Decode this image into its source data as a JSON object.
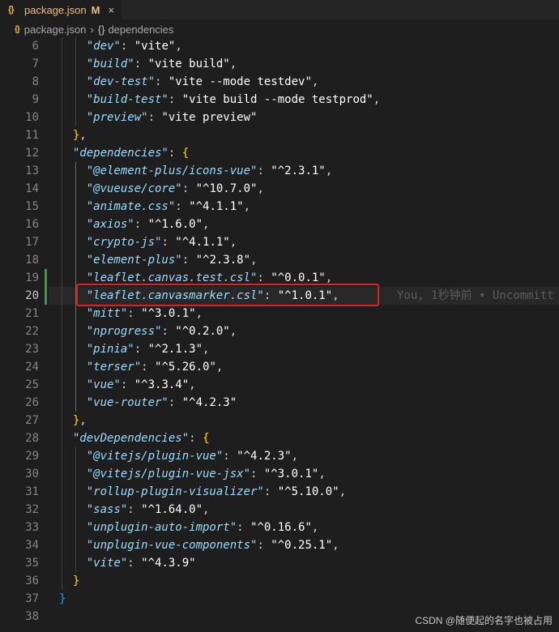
{
  "tab": {
    "icon": "{}",
    "icon_name": "json-icon",
    "filename": "package.json",
    "status": "M",
    "close": "×"
  },
  "breadcrumb": {
    "icon": "{}",
    "file": "package.json",
    "separator": "›",
    "braces": "{}",
    "path": "dependencies"
  },
  "blame": "You, 1秒钟前 • Uncommitt",
  "watermark": "CSDN @随便起的名字也被占用",
  "colors": {
    "key": "#9cdcfe",
    "brace": "#ffd700",
    "highlight_box": "#e02020",
    "modified_gutter": "#2ea043"
  },
  "lines": [
    {
      "n": "6",
      "k": "\"dev\"",
      "v": "\"vite\"",
      "end": ","
    },
    {
      "n": "7",
      "k": "\"build\"",
      "v": "\"vite build\"",
      "end": ","
    },
    {
      "n": "8",
      "k": "\"dev-test\"",
      "v": "\"vite --mode testdev\"",
      "end": ","
    },
    {
      "n": "9",
      "k": "\"build-test\"",
      "v": "\"vite build --mode testprod\"",
      "end": ","
    },
    {
      "n": "10",
      "k": "\"preview\"",
      "v": "\"vite preview\"",
      "end": ""
    },
    {
      "n": "11",
      "raw": "},",
      "indent": 1
    },
    {
      "n": "12",
      "k": "\"dependencies\"",
      "open": "{",
      "indent": 1
    },
    {
      "n": "13",
      "k": "\"@element-plus/icons-vue\"",
      "v": "\"^2.3.1\"",
      "end": ","
    },
    {
      "n": "14",
      "k": "\"@vueuse/core\"",
      "v": "\"^10.7.0\"",
      "end": ","
    },
    {
      "n": "15",
      "k": "\"animate.css\"",
      "v": "\"^4.1.1\"",
      "end": ","
    },
    {
      "n": "16",
      "k": "\"axios\"",
      "v": "\"^1.6.0\"",
      "end": ","
    },
    {
      "n": "17",
      "k": "\"crypto-js\"",
      "v": "\"^4.1.1\"",
      "end": ","
    },
    {
      "n": "18",
      "k": "\"element-plus\"",
      "v": "\"^2.3.8\"",
      "end": ","
    },
    {
      "n": "19",
      "k": "\"leaflet.canvas.test.csl\"",
      "v": "\"^0.0.1\"",
      "end": ","
    },
    {
      "n": "20",
      "k": "\"leaflet.canvasmarker.csl\"",
      "v": "\"^1.0.1\"",
      "end": ",",
      "active": true
    },
    {
      "n": "21",
      "k": "\"mitt\"",
      "v": "\"^3.0.1\"",
      "end": ","
    },
    {
      "n": "22",
      "k": "\"nprogress\"",
      "v": "\"^0.2.0\"",
      "end": ","
    },
    {
      "n": "23",
      "k": "\"pinia\"",
      "v": "\"^2.1.3\"",
      "end": ","
    },
    {
      "n": "24",
      "k": "\"terser\"",
      "v": "\"^5.26.0\"",
      "end": ","
    },
    {
      "n": "25",
      "k": "\"vue\"",
      "v": "\"^3.3.4\"",
      "end": ","
    },
    {
      "n": "26",
      "k": "\"vue-router\"",
      "v": "\"^4.2.3\"",
      "end": ""
    },
    {
      "n": "27",
      "raw": "},",
      "indent": 1
    },
    {
      "n": "28",
      "k": "\"devDependencies\"",
      "open": "{",
      "indent": 1
    },
    {
      "n": "29",
      "k": "\"@vitejs/plugin-vue\"",
      "v": "\"^4.2.3\"",
      "end": ","
    },
    {
      "n": "30",
      "k": "\"@vitejs/plugin-vue-jsx\"",
      "v": "\"^3.0.1\"",
      "end": ","
    },
    {
      "n": "31",
      "k": "\"rollup-plugin-visualizer\"",
      "v": "\"^5.10.0\"",
      "end": ","
    },
    {
      "n": "32",
      "k": "\"sass\"",
      "v": "\"^1.64.0\"",
      "end": ","
    },
    {
      "n": "33",
      "k": "\"unplugin-auto-import\"",
      "v": "\"^0.16.6\"",
      "end": ","
    },
    {
      "n": "34",
      "k": "\"unplugin-vue-components\"",
      "v": "\"^0.25.1\"",
      "end": ","
    },
    {
      "n": "35",
      "k": "\"vite\"",
      "v": "\"^4.3.9\"",
      "end": ""
    },
    {
      "n": "36",
      "raw": "}",
      "indent": 1
    },
    {
      "n": "37",
      "raw": "}",
      "indent": 0
    },
    {
      "n": "38",
      "raw": "",
      "indent": 0
    }
  ]
}
